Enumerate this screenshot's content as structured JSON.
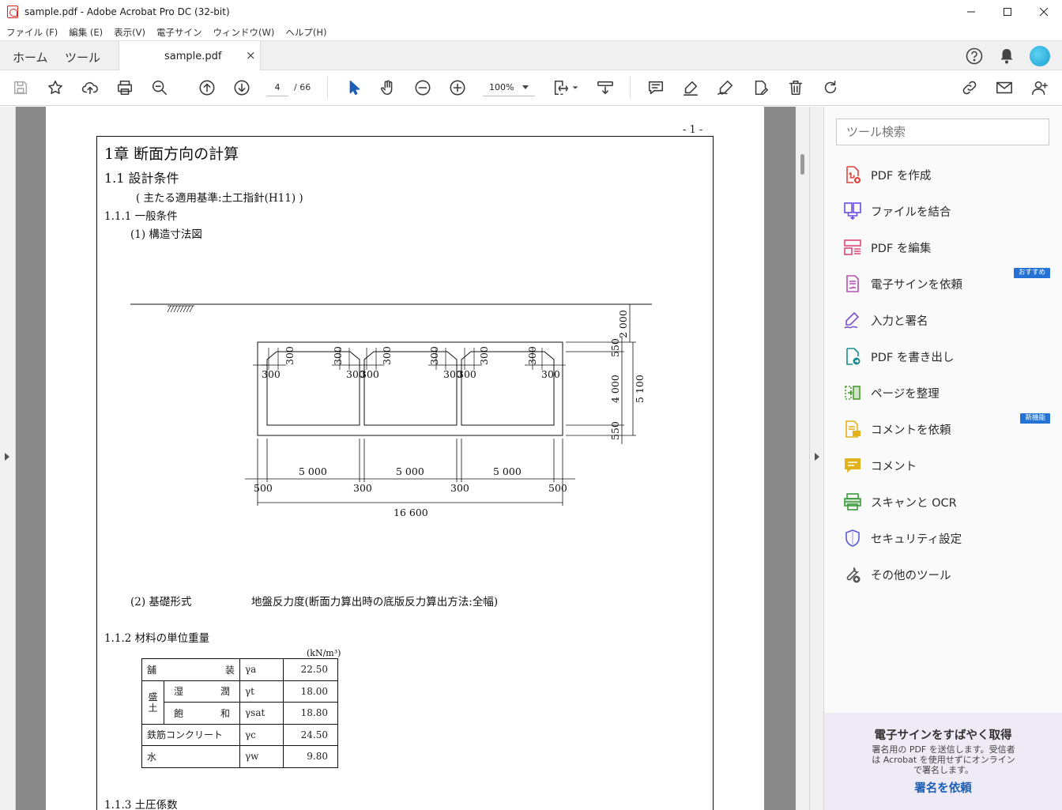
{
  "window": {
    "title": "sample.pdf - Adobe Acrobat Pro DC (32-bit)"
  },
  "menu": [
    "ファイル (F)",
    "編集 (E)",
    "表示(V)",
    "電子サイン",
    "ウィンドウ(W)",
    "ヘルプ(H)"
  ],
  "tabs": {
    "home": "ホーム",
    "tools": "ツール",
    "document": "sample.pdf",
    "close": "×"
  },
  "toolbar": {
    "page_current": "4",
    "page_total": "/ 66",
    "zoom": "100%"
  },
  "pdf": {
    "page_number": "- 1 -",
    "chapter": "1章 断面方向の計算",
    "section": "1.1 設計条件",
    "standard": "( 主たる適用基準:土工指針(H11) )",
    "subsection_1": "1.1.1 一般条件",
    "item_1": "(1) 構造寸法図",
    "item_2_label": "(2) 基礎形式",
    "item_2_value": "地盤反力度(断面力算出時の底版反力算出方法:全幅)",
    "subsection_2": "1.1.2 材料の単位重量",
    "unit": "(kN/m³)",
    "subsection_3": "1.1.3 土圧係数",
    "drawing": {
      "top_dims": [
        "300",
        "300",
        "300",
        "300",
        "300",
        "300"
      ],
      "corner_dims": [
        "300",
        "300",
        "300",
        "300",
        "300",
        "300"
      ],
      "span_dims": [
        "5 000",
        "5 000",
        "5 000"
      ],
      "bottom_dims": [
        "500",
        "300",
        "300",
        "500"
      ],
      "total_width": "16 600",
      "right_dims": [
        "2 000",
        "550",
        "4 000",
        "550"
      ],
      "total_height": "5 100"
    },
    "weights": {
      "paving": {
        "name": "舗 装",
        "symbol": "γa",
        "value": "22.50"
      },
      "fill_group": "盛土",
      "fill_wet": {
        "name": "湿 潤",
        "symbol": "γt",
        "value": "18.00"
      },
      "fill_sat": {
        "name": "飽 和",
        "symbol": "γsat",
        "value": "18.80"
      },
      "rc": {
        "name": "鉄筋コンクリート",
        "symbol": "γc",
        "value": "24.50"
      },
      "water": {
        "name": "水",
        "symbol": "γw",
        "value": "9.80"
      }
    }
  },
  "panel": {
    "search_placeholder": "ツール検索",
    "tools": [
      {
        "label": "PDF を作成",
        "icon": "create-pdf-icon",
        "color": "#e0453e"
      },
      {
        "label": "ファイルを結合",
        "icon": "combine-files-icon",
        "color": "#6a4be4"
      },
      {
        "label": "PDF を編集",
        "icon": "edit-pdf-icon",
        "color": "#e0457b"
      },
      {
        "label": "電子サインを依頼",
        "icon": "request-signature-icon",
        "color": "#b54fb6",
        "badge": "おすすめ"
      },
      {
        "label": "入力と署名",
        "icon": "fill-sign-icon",
        "color": "#7a4fcf"
      },
      {
        "label": "PDF を書き出し",
        "icon": "export-pdf-icon",
        "color": "#1d8c8c"
      },
      {
        "label": "ページを整理",
        "icon": "organize-pages-icon",
        "color": "#4a9e2e"
      },
      {
        "label": "コメントを依頼",
        "icon": "request-comment-icon",
        "color": "#e3b11c",
        "badge": "新機能"
      },
      {
        "label": "コメント",
        "icon": "comment-icon",
        "color": "#e3b11c"
      },
      {
        "label": "スキャンと OCR",
        "icon": "scan-ocr-icon",
        "color": "#3a9a3a"
      },
      {
        "label": "セキュリティ設定",
        "icon": "security-icon",
        "color": "#5a5ad6"
      },
      {
        "label": "その他のツール",
        "icon": "more-tools-icon",
        "color": "#555555"
      }
    ],
    "promo": {
      "title": "電子サインをすばやく取得",
      "description": "署名用の PDF を送信します。受信者は Acrobat を使用せずにオンラインで署名します。",
      "link": "署名を依頼"
    }
  }
}
